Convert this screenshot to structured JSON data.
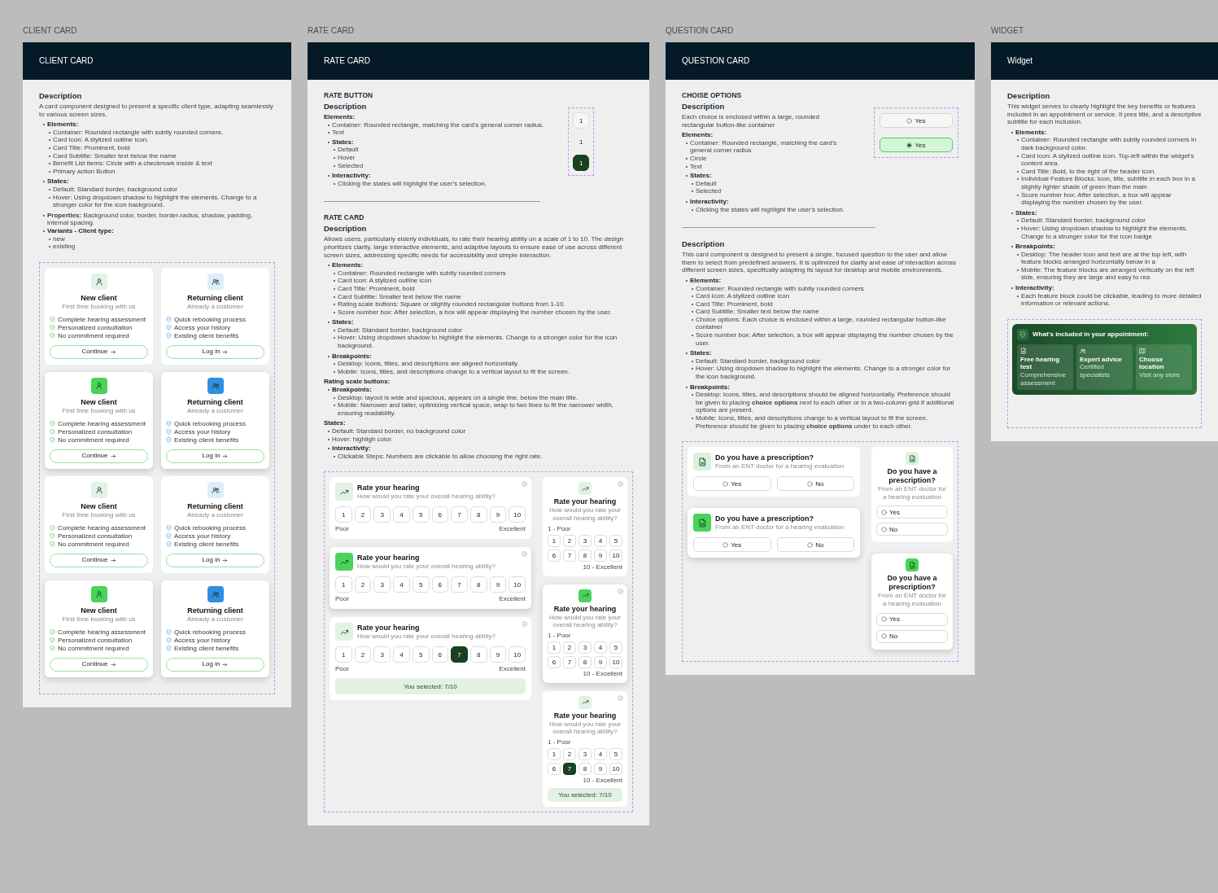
{
  "frames": [
    {
      "kind": "client",
      "label": "CLIENT CARD",
      "title": "CLIENT CARD",
      "sections": [
        {
          "description": [
            {
              "kind": "heading",
              "text": "Description"
            },
            {
              "kind": "paragraph",
              "text": "A card component designed to present a specific client type, adapting seamlessly to various screen sizes."
            },
            {
              "kind": "list",
              "items": [
                {
                  "label": "Elements:",
                  "children": [
                    "Container: Rounded rectangle with subtly rounded corners.",
                    "Card Icon: A stylized outline icon.",
                    "Card Title: Prominent, bold",
                    "Card Subtitle: Smaller text below the name",
                    "Benefit List items: Circle with a checkmark inside & text",
                    "Primary action Button"
                  ]
                },
                {
                  "label": "States:",
                  "children": [
                    "Default: Standard border, background color",
                    "Hover: Using dropdown shadow to highlight the elements. Change to a stronger color for the icon background."
                  ]
                },
                {
                  "text": "**Properties:** Background color, border, border-radius, shadow, padding, internal spacing."
                },
                {
                  "label": "Variants - Client type:",
                  "children": [
                    "new",
                    "existing"
                  ]
                }
              ]
            }
          ],
          "demo": {
            "kind": "client_cards",
            "cards": [
              {
                "kind": "new",
                "hover": false,
                "title": "New client",
                "subtitle": "First time booking with us",
                "benefits": [
                  "Complete hearing assessment",
                  "Personalized consultation",
                  "No commitment required"
                ],
                "action": "Continue"
              },
              {
                "kind": "returning",
                "hover": false,
                "title": "Returning client",
                "subtitle": "Already a customer",
                "benefits": [
                  "Quick rebooking process",
                  "Access your history",
                  "Existing client benefits"
                ],
                "action": "Log in"
              },
              {
                "kind": "new",
                "hover": true,
                "title": "New client",
                "subtitle": "First time booking with us",
                "benefits": [
                  "Complete hearing assessment",
                  "Personalized consultation",
                  "No commitment required"
                ],
                "action": "Continue"
              },
              {
                "kind": "returning",
                "hover": true,
                "title": "Returning client",
                "subtitle": "Already a customer",
                "benefits": [
                  "Quick rebooking process",
                  "Access your history",
                  "Existing client benefits"
                ],
                "action": "Log in"
              },
              {
                "kind": "new",
                "hover": false,
                "title": "New client",
                "subtitle": "First time booking with us",
                "benefits": [
                  "Complete hearing assessment",
                  "Personalized consultation",
                  "No commitment required"
                ],
                "action": "Continue"
              },
              {
                "kind": "returning",
                "hover": false,
                "title": "Returning client",
                "subtitle": "Already a customer",
                "benefits": [
                  "Quick rebooking process",
                  "Access your history",
                  "Existing client benefits"
                ],
                "action": "Log in"
              },
              {
                "kind": "new",
                "hover": true,
                "title": "New client",
                "subtitle": "First time booking with us",
                "benefits": [
                  "Complete hearing assessment",
                  "Personalized consultation",
                  "No commitment required"
                ],
                "action": "Continue"
              },
              {
                "kind": "returning",
                "hover": true,
                "title": "Returning client",
                "subtitle": "Already a customer",
                "benefits": [
                  "Quick rebooking process",
                  "Access your history",
                  "Existing client benefits"
                ],
                "action": "Log in"
              }
            ]
          }
        }
      ]
    },
    {
      "kind": "rate",
      "label": "RATE CARD",
      "title": "RATE CARD",
      "sections": [
        {
          "title": "RATE BUTTON",
          "description": [
            {
              "kind": "heading",
              "text": "Description"
            },
            {
              "kind": "label",
              "text": "Elements:"
            },
            {
              "kind": "list",
              "items": [
                {
                  "text": "Container: Rounded rectangle, matching the card's general corner radius."
                },
                {
                  "text": "Text"
                }
              ]
            },
            {
              "kind": "list",
              "items": [
                {
                  "label": "States:",
                  "children": [
                    "Default",
                    "Hover",
                    "Selected"
                  ]
                },
                {
                  "label": "Interactivity:",
                  "children": [
                    "Clicking the states will highlight the user's selection."
                  ]
                }
              ]
            }
          ],
          "demo": {
            "kind": "rate_buttons",
            "buttons": [
              {
                "label": "1",
                "kind": "default"
              },
              {
                "label": "1",
                "kind": "hover"
              },
              {
                "label": "1",
                "kind": "selected"
              }
            ]
          }
        },
        {
          "title": "RATE CARD",
          "description": [
            {
              "kind": "heading",
              "text": "Description"
            },
            {
              "kind": "paragraph",
              "text": "Allows users, particularly elderly individuals, to rate their hearing ability on a scale of 1 to 10. The design prioritizes clarity, large interactive elements, and adaptive layouts to ensure ease of use across different screen sizes, addressing specific needs for accessibility and simple interaction."
            },
            {
              "kind": "list",
              "items": [
                {
                  "label": "Elements:",
                  "children": [
                    "Container: Rounded rectangle with subtly rounded corners",
                    "Card Icon: A stylized outline icon",
                    "Card Title: Prominent, bold",
                    "Card Subtitle: Smaller text below the name",
                    "Rating scale buttons: Square or slightly rounded rectangular buttons from 1-10.",
                    "Score number box: After selection, a box will appear displaying the number chosen by the user."
                  ]
                },
                {
                  "label": "States:",
                  "children": [
                    "Default: Standard border, background color",
                    "Hover: Using dropdown shadow to highlight the elements. Change to a stronger color for the icon background."
                  ]
                },
                {
                  "label": "Breakpoints:",
                  "children": [
                    "Desktop: Icons, titles, and descriptions are aligned horizontally.",
                    "Mobile: Icons, titles, and descriptions change to a vertical layout to fit the screen."
                  ]
                }
              ]
            },
            {
              "kind": "label",
              "text": "Rating scale buttons:"
            },
            {
              "kind": "list",
              "items": [
                {
                  "label": "Breakpoints:",
                  "children": [
                    "Desktop: layout is wide and spacious, appears on a single line, below the main title.",
                    "Mobile: Narrower and taller, optimizing vertical space, wrap to two lines to fit the narrower width, ensuring readability."
                  ]
                }
              ]
            },
            {
              "kind": "label",
              "text": "States:"
            },
            {
              "kind": "list",
              "items": [
                {
                  "text": "Default: Standard border, no background color"
                },
                {
                  "text": "Hover: highligh color."
                }
              ]
            },
            {
              "kind": "list",
              "items": [
                {
                  "label": "Interactivity:",
                  "children": [
                    "Clickable Steps: Numbers are clickable to allow choosing the right rate."
                  ]
                }
              ]
            }
          ],
          "demo": {
            "kind": "rate_cards",
            "cards": [
              {
                "kind": "desktop",
                "hover": false,
                "title": "Rate your hearing",
                "subtitle": "How would you rate your overall hearing ability?",
                "low_label": "Poor",
                "high_label": "Excellent",
                "scale": [
                  {
                    "label": "1",
                    "selected": false
                  },
                  {
                    "label": "2",
                    "selected": false
                  },
                  {
                    "label": "3",
                    "selected": false
                  },
                  {
                    "label": "4",
                    "selected": false
                  },
                  {
                    "label": "5",
                    "selected": false
                  },
                  {
                    "label": "6",
                    "selected": false
                  },
                  {
                    "label": "7",
                    "selected": false
                  },
                  {
                    "label": "8",
                    "selected": false
                  },
                  {
                    "label": "9",
                    "selected": false
                  },
                  {
                    "label": "10",
                    "selected": false
                  }
                ]
              },
              {
                "kind": "desktop",
                "hover": true,
                "title": "Rate your hearing",
                "subtitle": "How would you rate your overall hearing ability?",
                "low_label": "Poor",
                "high_label": "Excellent",
                "scale": [
                  {
                    "label": "1",
                    "selected": false
                  },
                  {
                    "label": "2",
                    "selected": false
                  },
                  {
                    "label": "3",
                    "selected": false
                  },
                  {
                    "label": "4",
                    "selected": false
                  },
                  {
                    "label": "5",
                    "selected": false
                  },
                  {
                    "label": "6",
                    "selected": false
                  },
                  {
                    "label": "7",
                    "selected": false
                  },
                  {
                    "label": "8",
                    "selected": false
                  },
                  {
                    "label": "9",
                    "selected": false
                  },
                  {
                    "label": "10",
                    "selected": false
                  }
                ]
              },
              {
                "kind": "desktop",
                "hover": false,
                "title": "Rate your hearing",
                "subtitle": "How would you rate your overall hearing ability?",
                "low_label": "Poor",
                "high_label": "Excellent",
                "scale": [
                  {
                    "label": "1",
                    "selected": false
                  },
                  {
                    "label": "2",
                    "selected": false
                  },
                  {
                    "label": "3",
                    "selected": false
                  },
                  {
                    "label": "4",
                    "selected": false
                  },
                  {
                    "label": "5",
                    "selected": false
                  },
                  {
                    "label": "6",
                    "selected": false
                  },
                  {
                    "label": "7",
                    "selected": true
                  },
                  {
                    "label": "8",
                    "selected": false
                  },
                  {
                    "label": "9",
                    "selected": false
                  },
                  {
                    "label": "10",
                    "selected": false
                  }
                ],
                "result": "You selected: 7/10"
              },
              {
                "kind": "mobile",
                "hover": false,
                "title": "Rate your hearing",
                "subtitle": "How would you rate your overall hearing ability?",
                "low_label": "1 - Poor",
                "high_label": "10 - Excellent",
                "scale": [
                  {
                    "label": "1",
                    "selected": false
                  },
                  {
                    "label": "2",
                    "selected": false
                  },
                  {
                    "label": "3",
                    "selected": false
                  },
                  {
                    "label": "4",
                    "selected": false
                  },
                  {
                    "label": "5",
                    "selected": false
                  },
                  {
                    "label": "6",
                    "selected": false
                  },
                  {
                    "label": "7",
                    "selected": false
                  },
                  {
                    "label": "8",
                    "selected": false
                  },
                  {
                    "label": "9",
                    "selected": false
                  },
                  {
                    "label": "10",
                    "selected": false
                  }
                ]
              },
              {
                "kind": "mobile",
                "hover": true,
                "title": "Rate your hearing",
                "subtitle": "How would you rate your overall hearing ability?",
                "low_label": "1 - Poor",
                "high_label": "10 - Excellent",
                "scale": [
                  {
                    "label": "1",
                    "selected": false
                  },
                  {
                    "label": "2",
                    "selected": false
                  },
                  {
                    "label": "3",
                    "selected": false
                  },
                  {
                    "label": "4",
                    "selected": false
                  },
                  {
                    "label": "5",
                    "selected": false
                  },
                  {
                    "label": "6",
                    "selected": false
                  },
                  {
                    "label": "7",
                    "selected": false
                  },
                  {
                    "label": "8",
                    "selected": false
                  },
                  {
                    "label": "9",
                    "selected": false
                  },
                  {
                    "label": "10",
                    "selected": false
                  }
                ]
              },
              {
                "kind": "mobile",
                "hover": false,
                "title": "Rate your hearing",
                "subtitle": "How would you rate your overall hearing ability?",
                "low_label": "1 - Poor",
                "high_label": "10 - Excellent",
                "scale": [
                  {
                    "label": "1",
                    "selected": false
                  },
                  {
                    "label": "2",
                    "selected": false
                  },
                  {
                    "label": "3",
                    "selected": false
                  },
                  {
                    "label": "4",
                    "selected": false
                  },
                  {
                    "label": "5",
                    "selected": false
                  },
                  {
                    "label": "6",
                    "selected": false
                  },
                  {
                    "label": "7",
                    "selected": true
                  },
                  {
                    "label": "8",
                    "selected": false
                  },
                  {
                    "label": "9",
                    "selected": false
                  },
                  {
                    "label": "10",
                    "selected": false
                  }
                ],
                "result": "You selected: 7/10"
              }
            ]
          }
        }
      ]
    },
    {
      "kind": "question",
      "label": "QUESTION CARD",
      "title": "QUESTION CARD",
      "sections": [
        {
          "title": "CHOISE OPTIONS",
          "description": [
            {
              "kind": "heading",
              "text": "Description"
            },
            {
              "kind": "paragraph",
              "text": "Each choice is enclosed within a large, rounded rectangular button-like container"
            },
            {
              "kind": "label",
              "text": "Elements:"
            },
            {
              "kind": "list",
              "items": [
                {
                  "text": "Container: Rounded rectangle, matching the card's general corner radius"
                },
                {
                  "text": "Circle"
                },
                {
                  "text": "Text"
                }
              ]
            },
            {
              "kind": "list",
              "items": [
                {
                  "label": "States:",
                  "children": [
                    "Default",
                    "Selected"
                  ]
                },
                {
                  "label": "Interactivity:",
                  "children": [
                    "Clicking the states will highlight the user's selection."
                  ]
                }
              ]
            }
          ],
          "demo": {
            "kind": "choice_options",
            "options": [
              {
                "label": "Yes",
                "selected": false
              },
              {
                "label": "Yes",
                "selected": true
              }
            ]
          }
        },
        {
          "description": [
            {
              "kind": "heading",
              "text": "Description"
            },
            {
              "kind": "paragraph",
              "text": "This card component is designed to present a single, focused question to the user and allow them to select from predefined answers. It is optimized for clarity and ease of interaction across different screen sizes, specifically adapting its layout for desktop and mobile environments."
            },
            {
              "kind": "list",
              "items": [
                {
                  "label": "Elements:",
                  "children": [
                    "Container: Rounded rectangle with subtly rounded corners",
                    "Card Icon: A stylized outline icon",
                    "Card Title: Prominent, bold",
                    "Card Subtitle: Smaller text below the name",
                    "Choice options: Each choice is enclosed within a large, rounded rectangular button-like container",
                    "Score number box: After selection, a box will appear displaying the number chosen by the user."
                  ]
                },
                {
                  "label": "States:",
                  "children": [
                    "Default: Standard border, background color",
                    "Hover: Using dropdown shadow to highlight the elements. Change to a stronger color for the icon background."
                  ]
                },
                {
                  "label": "Breakpoints:",
                  "children": [
                    "Desktop: Icons, titles, and descriptions should be aligned horizontally. Preference should be given to placing **choice options** next to each other or in a two-column grid if additional options are present.",
                    "Mobile: Icons, titles, and descriptions change to a vertical layout to fit the screen. Preference should be given to placing **choice options** under to each other."
                  ]
                }
              ]
            }
          ],
          "demo": {
            "kind": "question_cards",
            "cards": [
              {
                "kind": "desktop",
                "hover": false,
                "title": "Do you have a prescription?",
                "subtitle": "From an ENT doctor for a hearing evaluation",
                "options": [
                  {
                    "label": "Yes",
                    "selected": false
                  },
                  {
                    "label": "No",
                    "selected": false
                  }
                ]
              },
              {
                "kind": "desktop",
                "hover": true,
                "title": "Do you have a prescription?",
                "subtitle": "From an ENT doctor for a hearing evaluation",
                "options": [
                  {
                    "label": "Yes",
                    "selected": false
                  },
                  {
                    "label": "No",
                    "selected": false
                  }
                ]
              },
              {
                "kind": "mobile",
                "hover": false,
                "title": "Do you have a prescription?",
                "subtitle": "From an ENT doctor for a hearing evaluation",
                "options": [
                  {
                    "label": "Yes",
                    "selected": false
                  },
                  {
                    "label": "No",
                    "selected": false
                  }
                ]
              },
              {
                "kind": "mobile",
                "hover": true,
                "title": "Do you have a prescription?",
                "subtitle": "From an ENT doctor for a hearing evaluation",
                "options": [
                  {
                    "label": "Yes",
                    "selected": false
                  },
                  {
                    "label": "No",
                    "selected": false
                  }
                ]
              }
            ]
          }
        }
      ]
    },
    {
      "kind": "widget",
      "label": "WIDGET",
      "title": "Widget",
      "sections": [
        {
          "description": [
            {
              "kind": "heading",
              "text": "Description"
            },
            {
              "kind": "paragraph",
              "text": "This widget serves to clearly highlight the key benefits or features included in an appointment or service. It pres title, and a descriptive subtitle for each inclusion."
            },
            {
              "kind": "list",
              "items": [
                {
                  "label": "Elements:",
                  "children": [
                    "Container: Rounded rectangle with subtly rounded corners in dark background color.",
                    "Card Icon: A stylized outline icon. Top-left within the widget's content area.",
                    "Card Title: Bold, to the right of the header icon.",
                    "Individual Feature Blocks: Icon, title, subtitle in each box in a slightly lighter shade of green than the main",
                    "Score number box: After selection, a box will appear displaying the number chosen by the user."
                  ]
                },
                {
                  "label": "States:",
                  "children": [
                    "Default: Standard border, background color",
                    "Hover: Using dropdown shadow to highlight the elements. Change to a stronger color for the icon badge"
                  ]
                },
                {
                  "label": "Breakpoints:",
                  "children": [
                    "Desktop: The header icon and text are at the top left, with feature blocks arranged horizontally below in a",
                    "Mobile: The feature blocks are arranged vertically on the left side, ensuring they are large and easy to rea"
                  ]
                },
                {
                  "label": "Interactivity:",
                  "children": [
                    "Each feature block could be clickable, leading to more detailed information or relevant actions."
                  ]
                }
              ]
            }
          ],
          "demo": {
            "kind": "widget",
            "widget": {
              "title": "What's included in your appointment:",
              "features": [
                {
                  "title": "Free hearing test",
                  "subtitle": "Comprehensive assessment"
                },
                {
                  "title": "Expert advice",
                  "subtitle": "Certified specialists"
                },
                {
                  "title": "Choose location",
                  "subtitle": "Visit any store"
                }
              ]
            }
          }
        }
      ]
    }
  ]
}
